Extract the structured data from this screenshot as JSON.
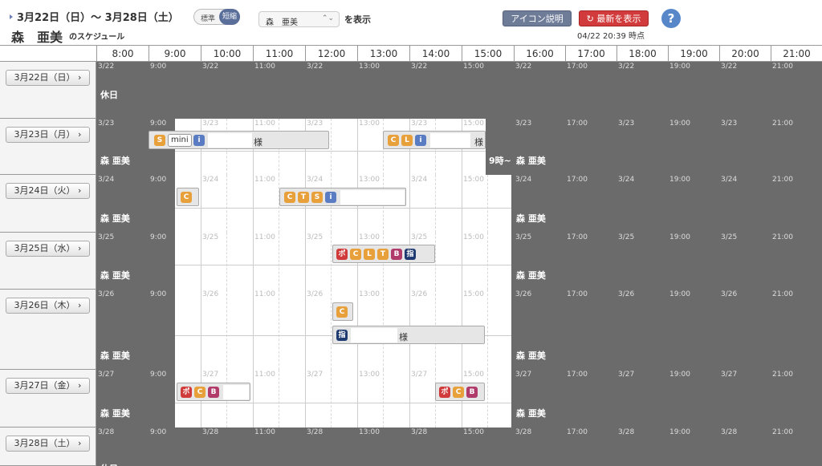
{
  "header": {
    "date_range": "3月22日（日）～ 3月28日（土）",
    "user_name": "森　亜美",
    "schedule_suffix": "のスケジュール",
    "toggle_standard": "標準",
    "toggle_short": "短縮",
    "selected_user": "森　亜美",
    "select_chevron": "⌃⌄",
    "show_label": "を表示",
    "icon_help_label": "アイコン説明",
    "refresh_label": "↻ 最新を表示",
    "updated_at": "04/22 20:39 時点",
    "help_symbol": "?"
  },
  "hours": [
    "8:00",
    "9:00",
    "10:00",
    "11:00",
    "12:00",
    "13:00",
    "14:00",
    "15:00",
    "16:00",
    "17:00",
    "18:00",
    "19:00",
    "20:00",
    "21:00"
  ],
  "days": [
    {
      "label": "3月22日（日）",
      "date": "3/22",
      "holiday": "休日"
    },
    {
      "label": "3月23日（月）",
      "date": "3/23",
      "name": "森 亜美",
      "name2": "森 亜美",
      "tail": "9時~"
    },
    {
      "label": "3月24日（火）",
      "date": "3/24",
      "name": "森 亜美",
      "name2": "森 亜美"
    },
    {
      "label": "3月25日（水）",
      "date": "3/25",
      "name": "森 亜美",
      "name2": "森 亜美"
    },
    {
      "label": "3月26日（木）",
      "date": "3/26",
      "name": "森 亜美",
      "name2": "森 亜美"
    },
    {
      "label": "3月27日（金）",
      "date": "3/27",
      "name": "森 亜美",
      "name2": "森 亜美"
    },
    {
      "label": "3月28日（土）",
      "date": "3/28",
      "holiday": "休日"
    }
  ],
  "events": {
    "mon_a_mini": "mini",
    "mon_a_suffix": "様",
    "mon_b_suffix": "様",
    "thu_b_suffix": "様"
  },
  "badges": {
    "S": "S",
    "C": "C",
    "L": "L",
    "T": "T",
    "i": "i",
    "P": "ポ",
    "B": "B",
    "shi": "指"
  },
  "colors": {
    "off_hours": "#6b6b6b",
    "working": "#ffffff",
    "badge_orange": "#e8a03a",
    "badge_blue": "#5a7cc2",
    "badge_red": "#d03a3a",
    "badge_navy": "#1e3a70"
  }
}
